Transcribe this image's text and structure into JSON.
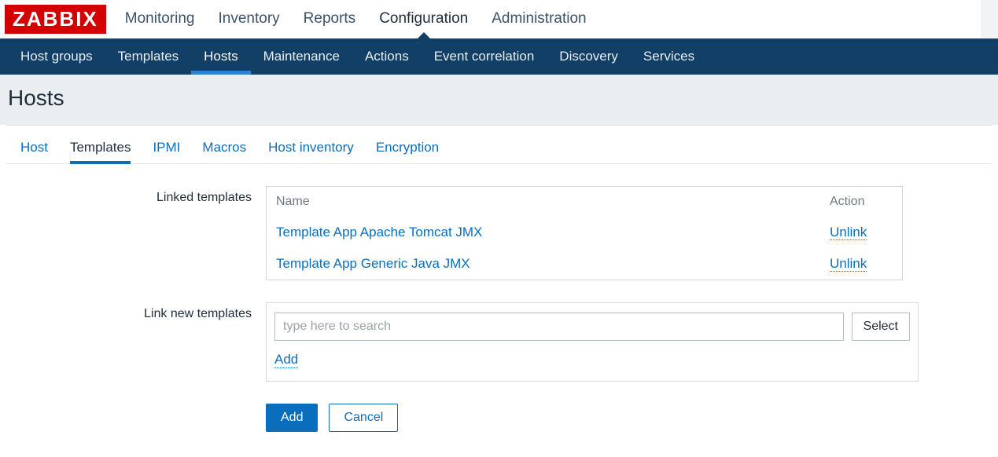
{
  "logo": "ZABBIX",
  "topnav": {
    "items": [
      "Monitoring",
      "Inventory",
      "Reports",
      "Configuration",
      "Administration"
    ],
    "active_index": 3
  },
  "subnav": {
    "items": [
      "Host groups",
      "Templates",
      "Hosts",
      "Maintenance",
      "Actions",
      "Event correlation",
      "Discovery",
      "Services"
    ],
    "active_index": 2
  },
  "page_title": "Hosts",
  "inner_tabs": {
    "items": [
      "Host",
      "Templates",
      "IPMI",
      "Macros",
      "Host inventory",
      "Encryption"
    ],
    "active_index": 1
  },
  "linked_templates": {
    "label": "Linked templates",
    "head_name": "Name",
    "head_action": "Action",
    "rows": [
      {
        "name": "Template App Apache Tomcat JMX",
        "action": "Unlink"
      },
      {
        "name": "Template App Generic Java JMX",
        "action": "Unlink"
      }
    ]
  },
  "link_new_templates": {
    "label": "Link new templates",
    "placeholder": "type here to search",
    "select_label": "Select",
    "add_link": "Add"
  },
  "buttons": {
    "primary": "Add",
    "secondary": "Cancel"
  }
}
